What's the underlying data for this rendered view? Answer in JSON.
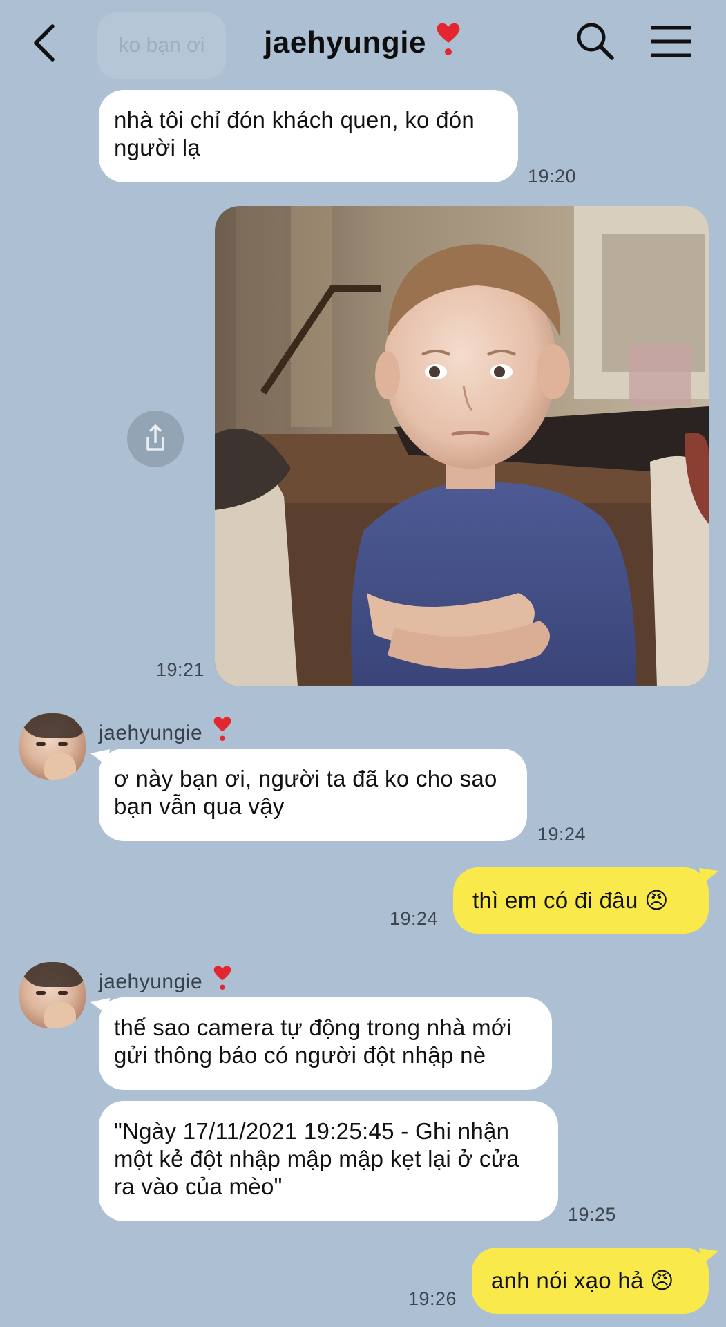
{
  "header": {
    "title": "jaehyungie",
    "ghost_message": "ko bạn ơi",
    "icons": [
      "back-arrow-icon",
      "heart-exclamation-emoji",
      "search-icon",
      "menu-icon"
    ]
  },
  "messages": [
    {
      "id": "m1",
      "side": "received",
      "text": "nhà tôi chỉ đón khách quen, ko đón người lạ",
      "time": "19:20"
    },
    {
      "id": "m2",
      "side": "sent",
      "type": "photo",
      "time": "19:21"
    },
    {
      "id": "m3",
      "side": "received",
      "sender": "jaehyungie",
      "text": "ơ này bạn ơi, người ta đã ko cho sao bạn vẫn qua vậy",
      "time": "19:24"
    },
    {
      "id": "m4",
      "side": "sent",
      "text": "thì em có đi đâu 😠",
      "time": "19:24"
    },
    {
      "id": "m5",
      "side": "received",
      "sender": "jaehyungie",
      "text": "thế sao camera tự động trong nhà mới gửi thông báo có người đột nhập nè"
    },
    {
      "id": "m6",
      "side": "received",
      "text": "\"Ngày 17/11/2021 19:25:45 - Ghi nhận một kẻ đột nhập mập mập kẹt lại ở cửa ra vào của mèo\"",
      "time": "19:25"
    },
    {
      "id": "m7",
      "side": "sent",
      "text": "anh nói xạo hả 😠",
      "time": "19:26"
    }
  ],
  "colors": {
    "background": "#adbfd2",
    "received_bubble": "#ffffff",
    "sent_bubble": "#f9e94a"
  }
}
